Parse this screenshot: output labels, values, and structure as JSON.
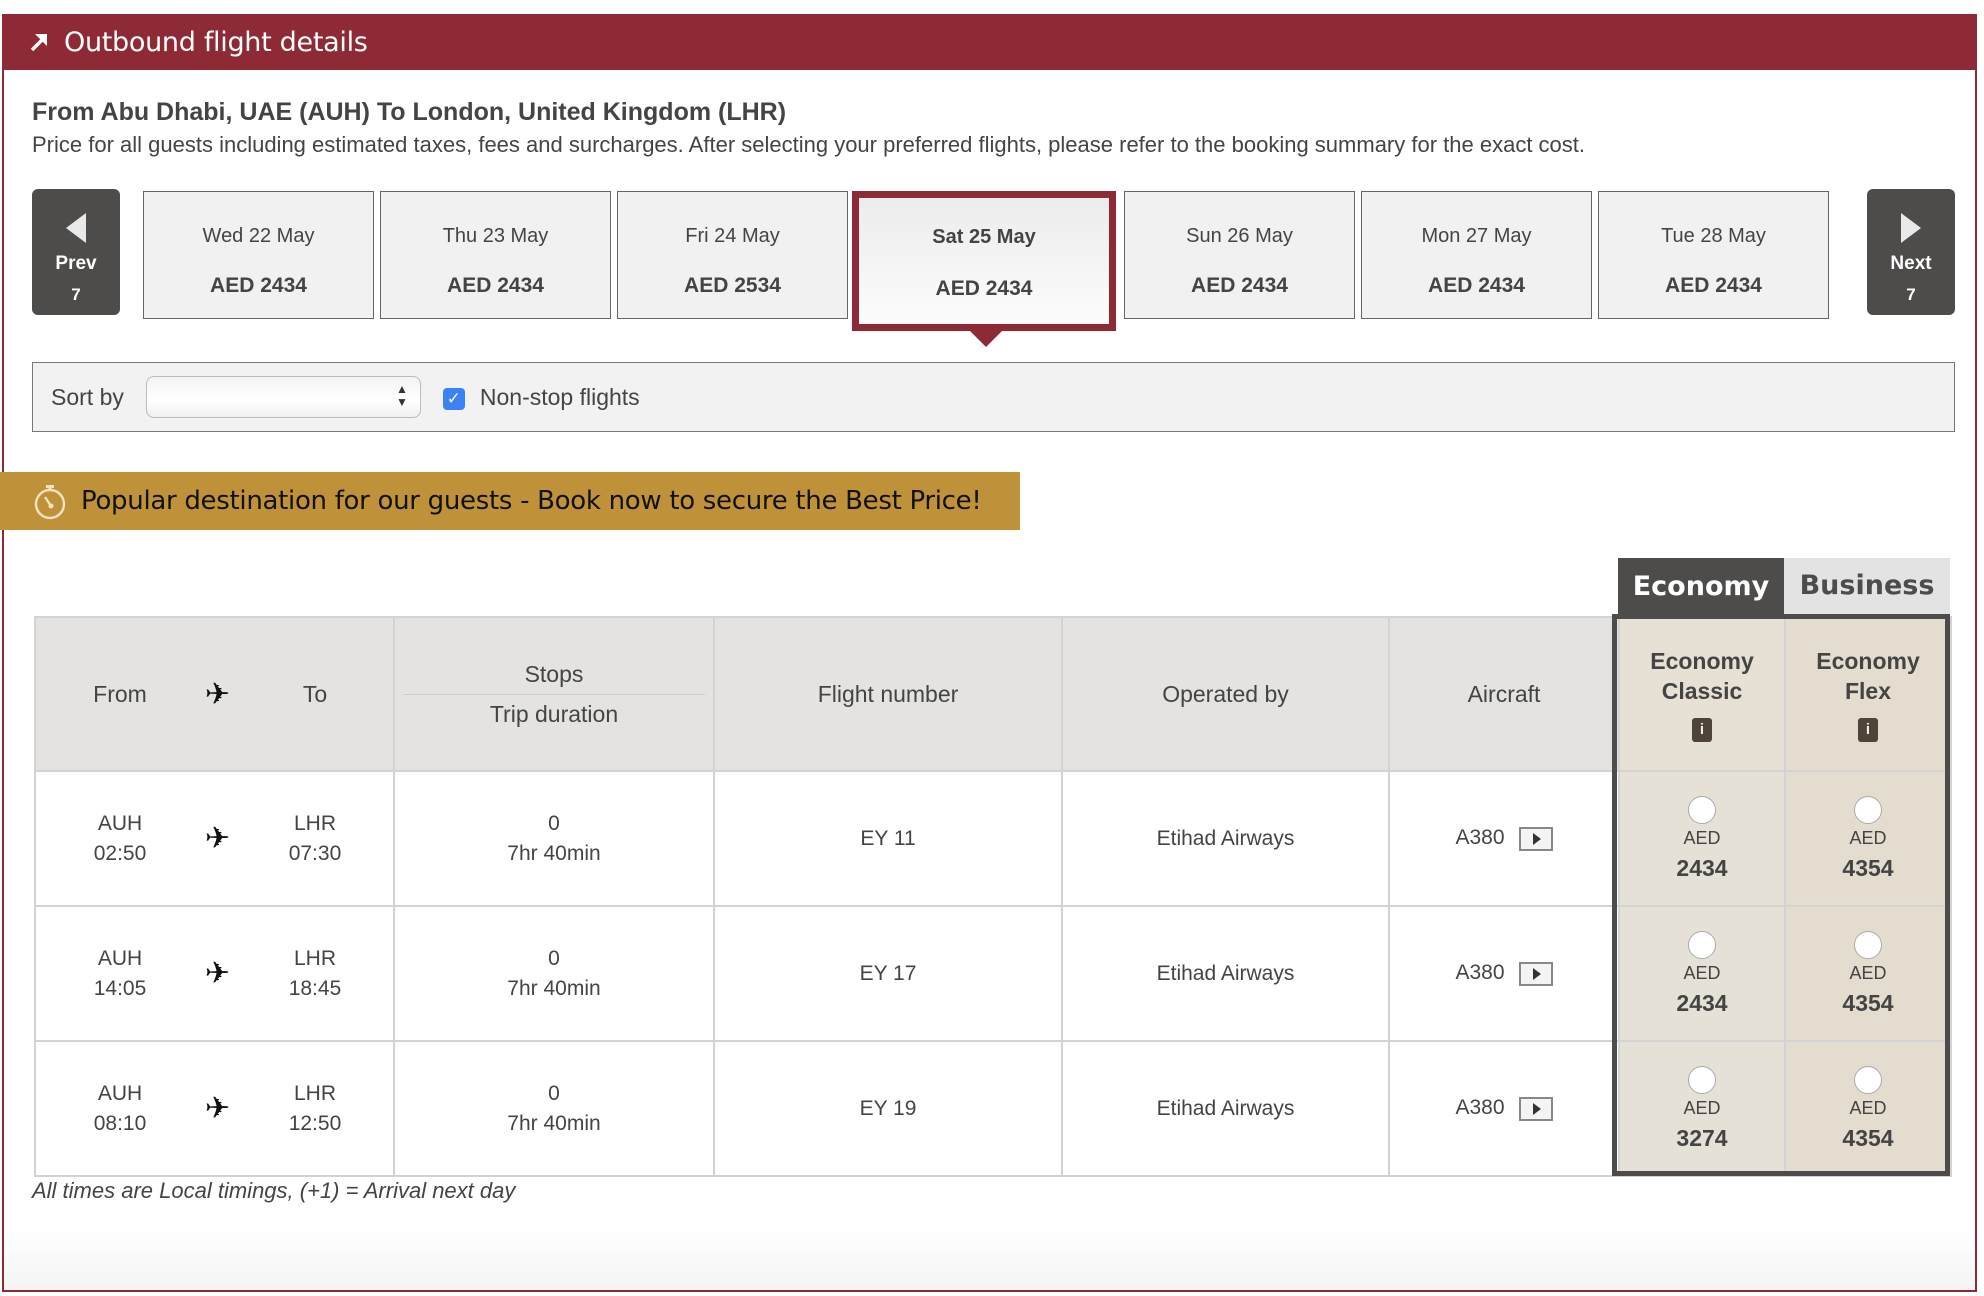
{
  "header": {
    "title": "Outbound flight details",
    "icon": "arrow-up-right-icon",
    "color": "#8e2a35"
  },
  "route": {
    "title": "From Abu Dhabi, UAE (AUH) To London, United Kingdom (LHR)",
    "subtitle": "Price for all guests including estimated taxes, fees and surcharges. After selecting your preferred flights, please refer to the booking summary for the exact cost."
  },
  "date_nav": {
    "prev": {
      "label": "Prev",
      "count": "7"
    },
    "next": {
      "label": "Next",
      "count": "7"
    },
    "dates": [
      {
        "day": "Wed 22 May",
        "price": "AED 2434",
        "selected": false
      },
      {
        "day": "Thu 23 May",
        "price": "AED 2434",
        "selected": false
      },
      {
        "day": "Fri 24 May",
        "price": "AED 2534",
        "selected": false
      },
      {
        "day": "Sat 25 May",
        "price": "AED 2434",
        "selected": true
      },
      {
        "day": "Sun 26 May",
        "price": "AED 2434",
        "selected": false
      },
      {
        "day": "Mon 27 May",
        "price": "AED 2434",
        "selected": false
      },
      {
        "day": "Tue 28 May",
        "price": "AED 2434",
        "selected": false
      }
    ]
  },
  "filters": {
    "sort_label": "Sort by",
    "sort_value": "",
    "nonstop_label": "Non-stop flights",
    "nonstop_checked": true
  },
  "promo": {
    "text": "Popular destination for our guests - Book now to secure the Best Price!",
    "color": "#bf9138"
  },
  "cabin_tabs": {
    "active": "Economy",
    "inactive": "Business"
  },
  "table": {
    "headers": {
      "from": "From",
      "to": "To",
      "stops": "Stops",
      "duration": "Trip duration",
      "flight_number": "Flight number",
      "operated_by": "Operated by",
      "aircraft": "Aircraft",
      "fare1": [
        "Economy",
        "Classic"
      ],
      "fare2": [
        "Economy",
        "Flex"
      ]
    },
    "rows": [
      {
        "from_code": "AUH",
        "from_time": "02:50",
        "to_code": "LHR",
        "to_time": "07:30",
        "stops": "0",
        "duration": "7hr 40min",
        "flight": "EY 11",
        "operator": "Etihad Airways",
        "aircraft": "A380",
        "fare1": {
          "currency": "AED",
          "amount": "2434"
        },
        "fare2": {
          "currency": "AED",
          "amount": "4354"
        }
      },
      {
        "from_code": "AUH",
        "from_time": "14:05",
        "to_code": "LHR",
        "to_time": "18:45",
        "stops": "0",
        "duration": "7hr 40min",
        "flight": "EY 17",
        "operator": "Etihad Airways",
        "aircraft": "A380",
        "fare1": {
          "currency": "AED",
          "amount": "2434"
        },
        "fare2": {
          "currency": "AED",
          "amount": "4354"
        }
      },
      {
        "from_code": "AUH",
        "from_time": "08:10",
        "to_code": "LHR",
        "to_time": "12:50",
        "stops": "0",
        "duration": "7hr 40min",
        "flight": "EY 19",
        "operator": "Etihad Airways",
        "aircraft": "A380",
        "fare1": {
          "currency": "AED",
          "amount": "3274"
        },
        "fare2": {
          "currency": "AED",
          "amount": "4354"
        }
      }
    ]
  },
  "footnote": "All times are Local timings, (+1) = Arrival next day"
}
